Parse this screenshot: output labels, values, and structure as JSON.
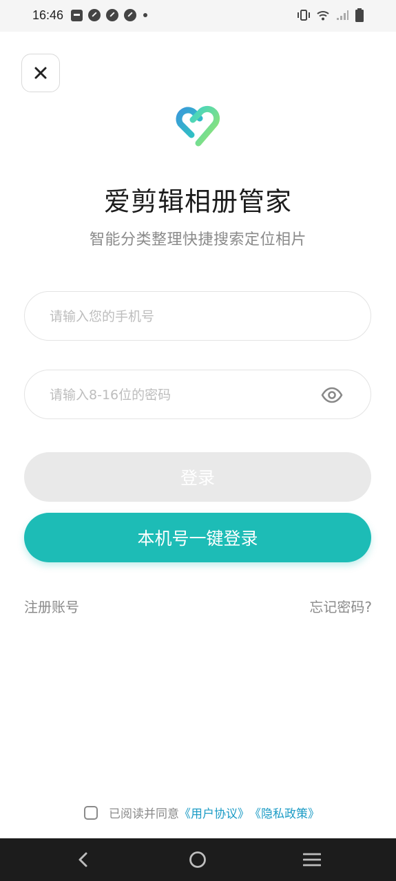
{
  "status_bar": {
    "time": "16:46"
  },
  "header": {
    "close_icon": "close-icon"
  },
  "brand": {
    "logo_icon": "heart-logo-icon",
    "logo_colors": [
      "#3a9ad9",
      "#7ee06b"
    ],
    "title": "爱剪辑相册管家",
    "subtitle": "智能分类整理快捷搜索定位相片"
  },
  "form": {
    "phone_placeholder": "请输入您的手机号",
    "password_placeholder": "请输入8-16位的密码",
    "eye_icon": "eye-icon",
    "login_label": "登录",
    "onekey_label": "本机号一键登录",
    "register_label": "注册账号",
    "forgot_label": "忘记密码?"
  },
  "agreement": {
    "prefix": "已阅读并同意",
    "user_agreement": "《用户协议》",
    "privacy_policy": "《隐私政策》",
    "checked": false
  },
  "colors": {
    "accent": "#1dbcb6",
    "link": "#1b9bc5",
    "disabled_button": "#e9e9e9"
  },
  "nav_bar": {
    "back_icon": "back-icon",
    "home_icon": "home-icon",
    "menu_icon": "menu-icon"
  }
}
